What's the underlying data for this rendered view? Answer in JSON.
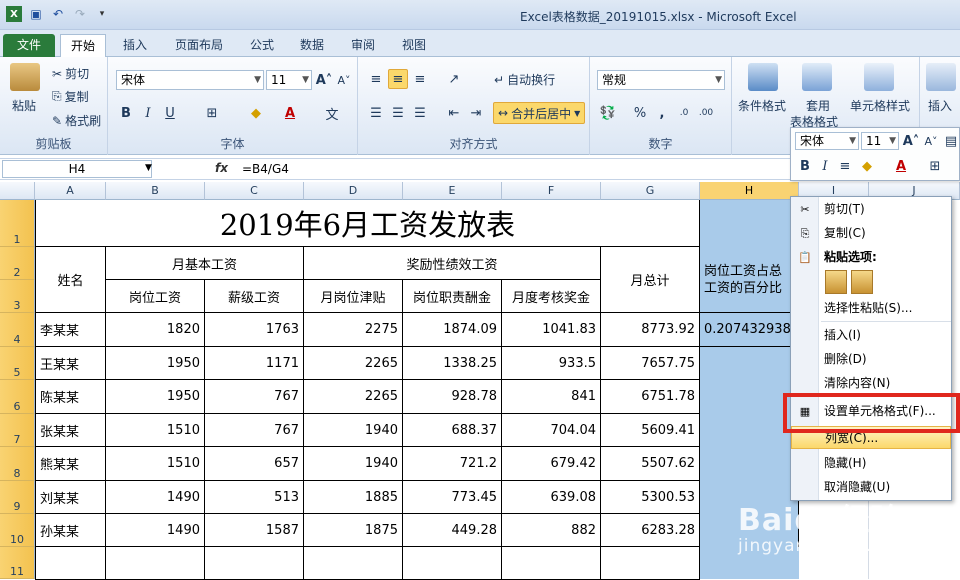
{
  "window": {
    "title": "Excel表格数据_20191015.xlsx  -  Microsoft Excel"
  },
  "tabs": [
    "文件",
    "开始",
    "插入",
    "页面布局",
    "公式",
    "数据",
    "审阅",
    "视图"
  ],
  "ribbon": {
    "clipboard": {
      "paste": "粘贴",
      "cut": "剪切",
      "copy": "复制",
      "format_painter": "格式刷",
      "label": "剪贴板"
    },
    "font": {
      "name": "宋体",
      "size": "11",
      "label": "字体"
    },
    "align": {
      "wrap": "自动换行",
      "merge": "合并后居中",
      "label": "对齐方式"
    },
    "number": {
      "format": "常规",
      "label": "数字"
    },
    "styles": {
      "cond": "条件格式",
      "table_line1": "套用",
      "table_line2": "表格格式",
      "cell": "单元格样式"
    },
    "cells": {
      "insert": "插入"
    }
  },
  "formula_bar": {
    "name_box": "H4",
    "fx": "fx",
    "formula": "=B4/G4"
  },
  "columns": [
    "A",
    "B",
    "C",
    "D",
    "E",
    "F",
    "G",
    "H",
    "I",
    "J"
  ],
  "rows": [
    "1",
    "2",
    "3",
    "4",
    "5",
    "6",
    "7",
    "8",
    "9",
    "10",
    "11"
  ],
  "sheet": {
    "title": "2019年6月工资发放表",
    "h_name": "姓名",
    "h_base": "月基本工资",
    "h_bonus": "奖励性绩效工资",
    "h_total": "月总计",
    "h_ratio": "岗位工资占总工资的百分比",
    "sub": [
      "岗位工资",
      "薪级工资",
      "月岗位津贴",
      "岗位职责酬金",
      "月度考核奖金"
    ],
    "data": [
      [
        "李某某",
        "1820",
        "1763",
        "2275",
        "1874.09",
        "1041.83",
        "8773.92",
        "0.207432938"
      ],
      [
        "王某某",
        "1950",
        "1171",
        "2265",
        "1338.25",
        "933.5",
        "7657.75",
        ""
      ],
      [
        "陈某某",
        "1950",
        "767",
        "2265",
        "928.78",
        "841",
        "6751.78",
        ""
      ],
      [
        "张某某",
        "1510",
        "767",
        "1940",
        "688.37",
        "704.04",
        "5609.41",
        ""
      ],
      [
        "熊某某",
        "1510",
        "657",
        "1940",
        "721.2",
        "679.42",
        "5507.62",
        ""
      ],
      [
        "刘某某",
        "1490",
        "513",
        "1885",
        "773.45",
        "639.08",
        "5300.53",
        ""
      ],
      [
        "孙某某",
        "1490",
        "1587",
        "1875",
        "449.28",
        "882",
        "6283.28",
        ""
      ]
    ]
  },
  "mini_toolbar": {
    "font": "宋体",
    "size": "11"
  },
  "context_menu": {
    "items": [
      "剪切(T)",
      "复制(C)",
      "粘贴选项:",
      "选择性粘贴(S)...",
      "插入(I)",
      "删除(D)",
      "清除内容(N)",
      "设置单元格格式(F)...",
      "列宽(C)...",
      "隐藏(H)",
      "取消隐藏(U)"
    ]
  },
  "watermark": {
    "line1": "Baidu经验",
    "line2": "jingyan.baidu.com"
  },
  "colors": {
    "accent": "#a9cbea",
    "file_tab": "#2a7b3b",
    "highlight": "#e0271d"
  }
}
